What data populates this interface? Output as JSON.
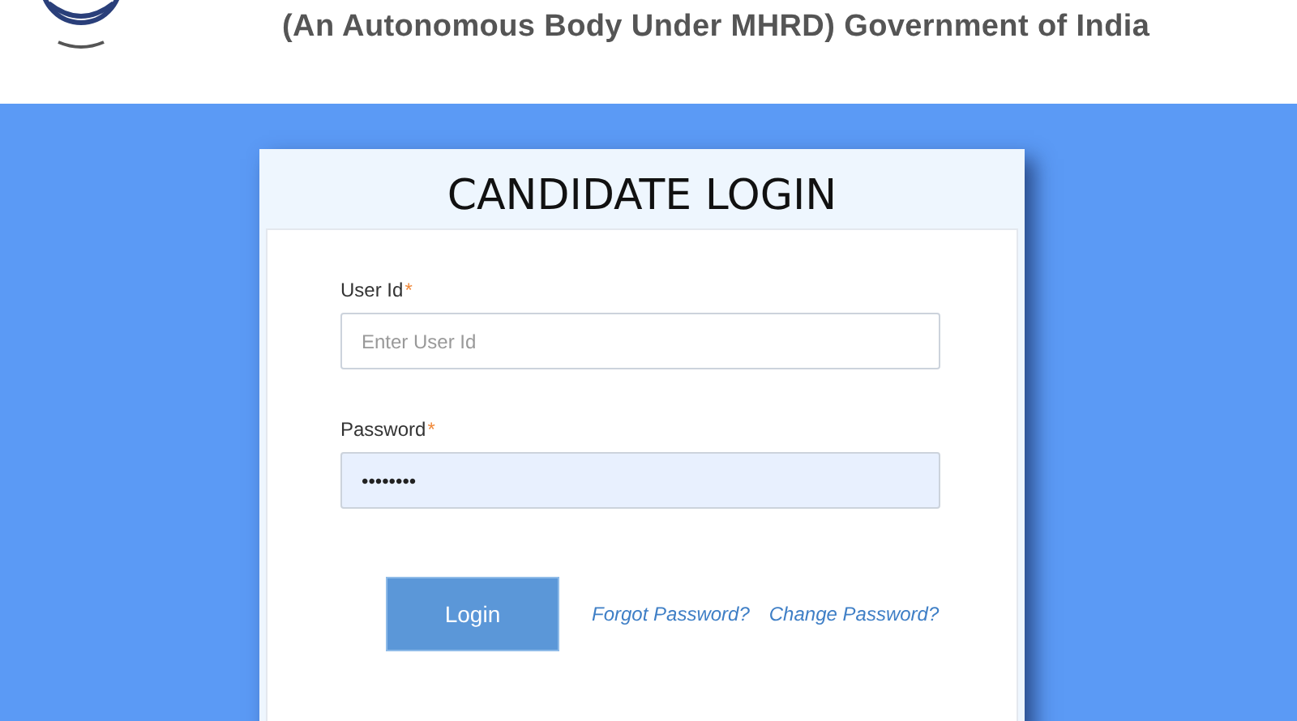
{
  "header": {
    "subtitle": "(An Autonomous Body Under MHRD) Government of India"
  },
  "login": {
    "title": "CANDIDATE LOGIN",
    "fields": [
      {
        "label": "User Id",
        "required_mark": "*",
        "placeholder": "Enter User Id",
        "filled": false
      },
      {
        "label": "Password",
        "required_mark": "*",
        "value": "••••••••",
        "filled": true
      }
    ],
    "button": "Login",
    "links": [
      "Forgot Password?",
      "Change Password?"
    ]
  }
}
